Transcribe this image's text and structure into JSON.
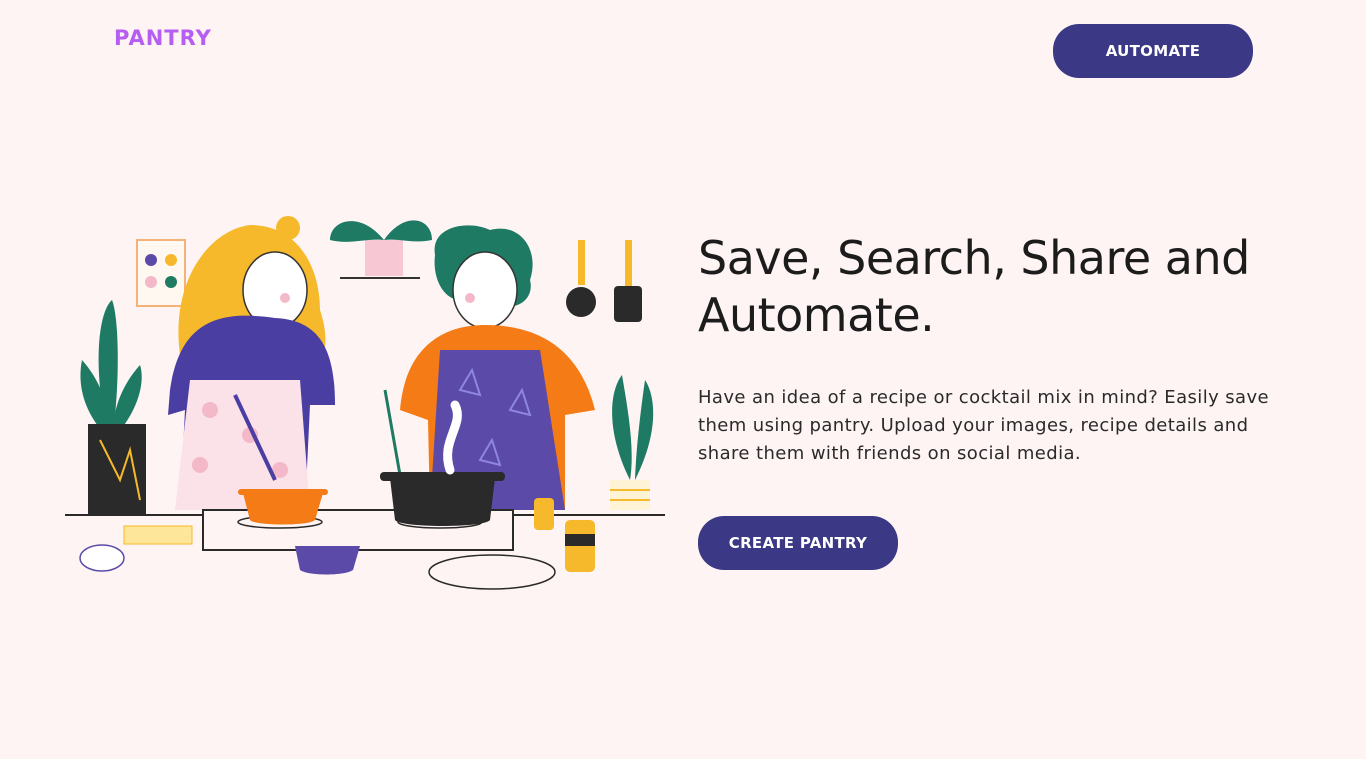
{
  "header": {
    "logo_text": "PANTRY",
    "automate_label": "AUTOMATE"
  },
  "hero": {
    "headline": "Save, Search, Share and Automate.",
    "description": "Have an idea of a recipe or cocktail mix in mind? Easily save them using pantry. Upload your images, recipe details and share them with friends on social media.",
    "cta_label": "CREATE PANTRY",
    "illustration": "cooking-couple-illustration"
  },
  "colors": {
    "background": "#fdf4f3",
    "brand": "#b65ef2",
    "button": "#3b3885",
    "heading": "#1c1c1c"
  }
}
